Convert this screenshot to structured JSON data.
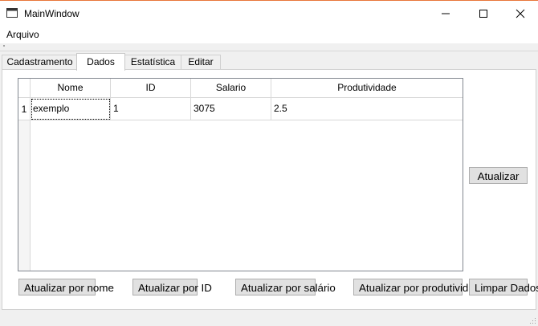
{
  "window": {
    "title": "MainWindow",
    "controls": [
      "minimize-icon",
      "maximize-icon",
      "close-icon"
    ]
  },
  "menu": {
    "items": [
      {
        "label": "Arquivo"
      }
    ]
  },
  "tabs": [
    {
      "label": "Cadastramento",
      "active": false
    },
    {
      "label": "Dados",
      "active": true
    },
    {
      "label": "Estatística",
      "active": false
    },
    {
      "label": "Editar",
      "active": false
    }
  ],
  "table": {
    "columns": [
      "Nome",
      "ID",
      "Salario",
      "Produtividade"
    ],
    "rows": [
      {
        "row_number": "1",
        "cells": [
          "exemplo",
          "1",
          "3075",
          "2.5"
        ]
      }
    ]
  },
  "buttons": {
    "atualizar": "Atualizar",
    "atualizar_nome": "Atualizar por nome",
    "atualizar_id": "Atualizar por ID",
    "atualizar_salario": "Atualizar por salário",
    "atualizar_produtividade": "Atualizar por produtividade",
    "limpar": "Limpar Dados"
  }
}
